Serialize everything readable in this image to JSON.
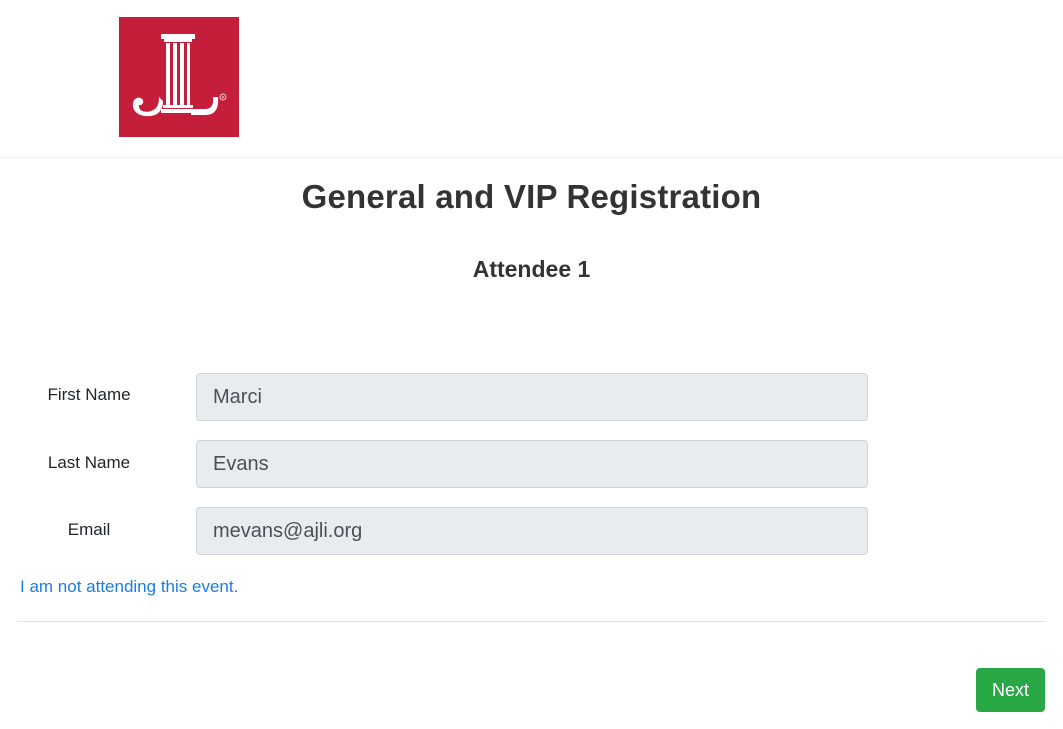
{
  "header": {
    "logo_icon": "jl-column-logo-icon",
    "logo_color": "#c41e3a",
    "logo_mark": "JL ®"
  },
  "main": {
    "title": "General and VIP Registration",
    "subtitle": "Attendee 1"
  },
  "form": {
    "first_name": {
      "label": "First Name",
      "value": "Marci"
    },
    "last_name": {
      "label": "Last Name",
      "value": "Evans"
    },
    "email": {
      "label": "Email",
      "value": "mevans@ajli.org"
    }
  },
  "links": {
    "not_attending": "I am not attending this event."
  },
  "actions": {
    "next_label": "Next",
    "next_color": "#28a745"
  }
}
